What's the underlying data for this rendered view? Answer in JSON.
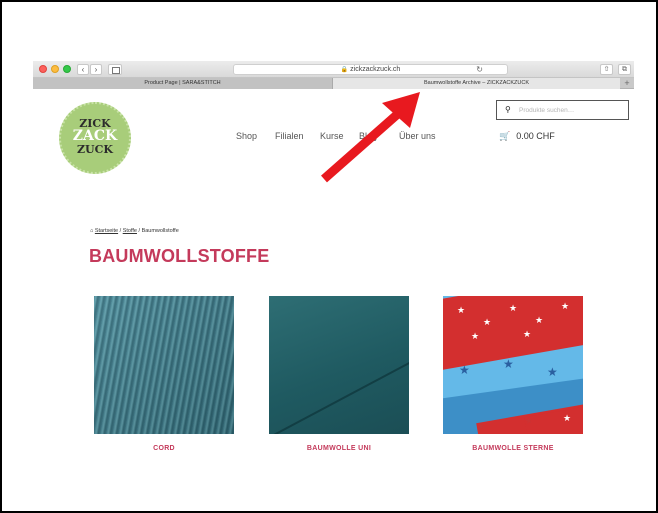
{
  "browser": {
    "url": "zickzackzuck.ch",
    "tabs": [
      {
        "label": "Product Page | SARA&STITCH"
      },
      {
        "label": "Baumwollstoffe Archive – ZICKZACKZUCK"
      }
    ],
    "icons": {
      "back": "‹",
      "forward": "›",
      "reload": "↻",
      "share": "⇧",
      "tabs": "⧉",
      "add_tab": "+"
    }
  },
  "logo": {
    "line1": "ZICK",
    "line2": "ZACK",
    "line3": "ZUCK",
    "color": "#a8cd7a"
  },
  "nav": {
    "items": [
      {
        "label": "Shop"
      },
      {
        "label": "Filialen"
      },
      {
        "label": "Kurse"
      },
      {
        "label": "Blog"
      },
      {
        "label": "Über uns"
      }
    ]
  },
  "search": {
    "placeholder": "Produkte suchen…",
    "icon": "🔍"
  },
  "cart": {
    "total": "0.00 CHF",
    "icon": "🛒"
  },
  "breadcrumb": {
    "home": "Startseite",
    "sep1": "/",
    "category": "Stoffe",
    "sep2": "/",
    "current": "Baumwollstoffe"
  },
  "page": {
    "title": "BAUMWOLLSTOFFE",
    "accent_color": "#c43a5b"
  },
  "products": [
    {
      "name": "CORD"
    },
    {
      "name": "BAUMWOLLE UNI"
    },
    {
      "name": "BAUMWOLLE STERNE"
    }
  ],
  "annotation": {
    "arrow_color": "#e8191f"
  }
}
